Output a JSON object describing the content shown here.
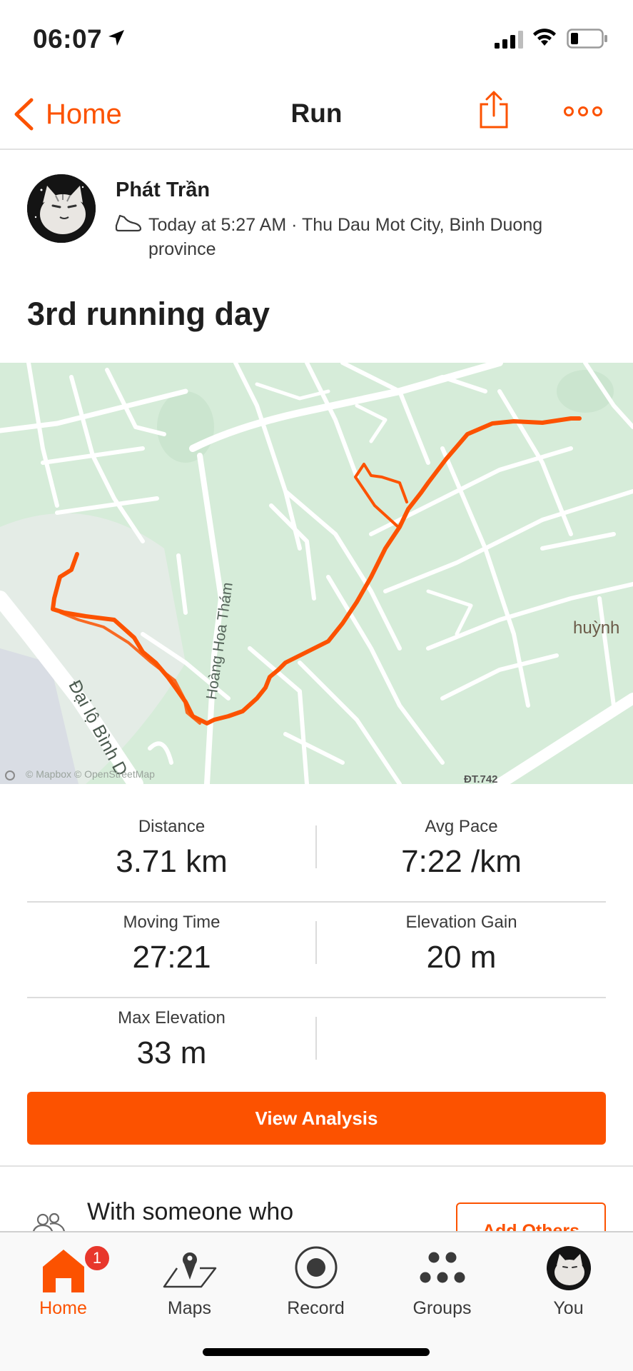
{
  "status_bar": {
    "time": "06:07"
  },
  "nav": {
    "back_label": "Home",
    "title": "Run"
  },
  "athlete": {
    "name": "Phát Trần",
    "meta": "Today at 5:27 AM · Thu Dau Mot City, Binh Duong province"
  },
  "activity": {
    "title": "3rd running day"
  },
  "map": {
    "labels": {
      "road_hoang_hoa_tham": "Hoàng Hoa Thám",
      "road_dai_lo": "Đại lộ Bình D",
      "place_huynh": "huỳnh",
      "road_dt742": "ĐT.742",
      "attribution": "© Mapbox © OpenStreetMap"
    },
    "route_color": "#fc5200",
    "land_color": "#d6ecd9"
  },
  "stats": [
    {
      "label": "Distance",
      "value": "3.71 km"
    },
    {
      "label": "Avg Pace",
      "value": "7:22 /km"
    },
    {
      "label": "Moving Time",
      "value": "27:21"
    },
    {
      "label": "Elevation Gain",
      "value": "20 m"
    },
    {
      "label": "Max Elevation",
      "value": "33 m"
    }
  ],
  "analysis_button": "View Analysis",
  "with_others": {
    "text": "With someone who",
    "button": "Add Others"
  },
  "tabs": [
    {
      "label": "Home",
      "icon": "home-icon",
      "badge": "1",
      "active": true
    },
    {
      "label": "Maps",
      "icon": "map-pin-icon"
    },
    {
      "label": "Record",
      "icon": "record-icon"
    },
    {
      "label": "Groups",
      "icon": "groups-icon"
    },
    {
      "label": "You",
      "icon": "avatar"
    }
  ],
  "colors": {
    "brand": "#fc5200",
    "badge": "#e8372c"
  }
}
